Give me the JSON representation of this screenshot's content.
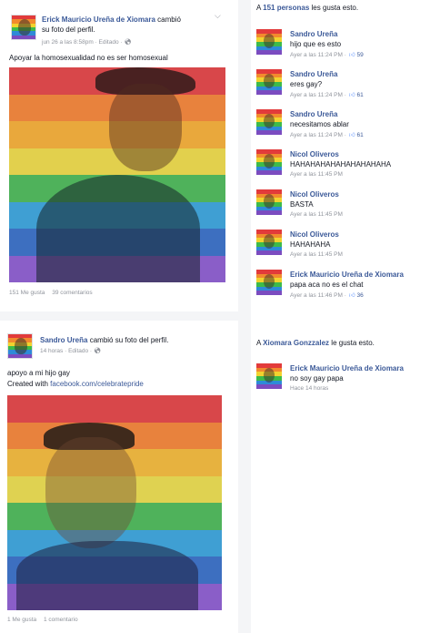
{
  "post1": {
    "author": "Erick Mauricio Ureña de Xiomara",
    "action_line1": "cambió",
    "action_line2": "su foto del perfil.",
    "meta": "jun 26 a las 8:58pm · Editado ·",
    "text": "Apoyar la homosexualidad no es ser homosexual",
    "likes": "151 Me gusta",
    "comments": "39 comentarios"
  },
  "post2": {
    "author": "Sandro Ureña",
    "action": "cambió su foto del perfil.",
    "meta": "14 horas · Editado ·",
    "text_line1": "apoyo a mi hijo gay",
    "text_line2_prefix": "Created with",
    "link": "facebook.com/celebratepride",
    "likes": "1 Me gusta",
    "comments": "1 comentario"
  },
  "likes_summary_1": {
    "prefix": "A",
    "count": "151 personas",
    "suffix": "les gusta esto."
  },
  "comments_1": [
    {
      "name": "Sandro Ureña",
      "text": "hijo que es esto",
      "meta": "Ayer a las 11:24 PM ·",
      "likes": "59"
    },
    {
      "name": "Sandro Ureña",
      "text": "eres gay?",
      "meta": "Ayer a las 11:24 PM ·",
      "likes": "61"
    },
    {
      "name": "Sandro Ureña",
      "text": "necesitamos ablar",
      "meta": "Ayer a las 11:24 PM ·",
      "likes": "61"
    },
    {
      "name": "Nicol Oliveros",
      "text": "HAHAHAHAHAHAHAHAHAHA",
      "meta": "Ayer a las 11:45 PM",
      "likes": ""
    },
    {
      "name": "Nicol Oliveros",
      "text": "BASTA",
      "meta": "Ayer a las 11:45 PM",
      "likes": ""
    },
    {
      "name": "Nicol Oliveros",
      "text": "HAHAHAHA",
      "meta": "Ayer a las 11:45 PM",
      "likes": ""
    },
    {
      "name": "Erick Mauricio Ureña de Xiomara",
      "text": "papa aca no es el chat",
      "meta": "Ayer a las 11:46 PM ·",
      "likes": "36"
    }
  ],
  "likes_summary_2": {
    "prefix": "A",
    "name": "Xiomara Gonzzalez",
    "suffix": "le gusta esto."
  },
  "comments_2": [
    {
      "name": "Erick Mauricio Ureña de Xiomara",
      "text": "no soy gay papa",
      "meta": "Hace 14 horas",
      "likes": ""
    }
  ],
  "icons": {
    "chevron": "chevron-down-icon",
    "globe": "globe-icon",
    "thumb": "thumb-up-icon"
  },
  "colors": {
    "brand": "#3b5998",
    "meta": "#90949c",
    "rainbow": [
      "#e23b3b",
      "#f28a2e",
      "#f2d22e",
      "#3dbb4a",
      "#2e8ad8",
      "#7b4cc0"
    ]
  }
}
